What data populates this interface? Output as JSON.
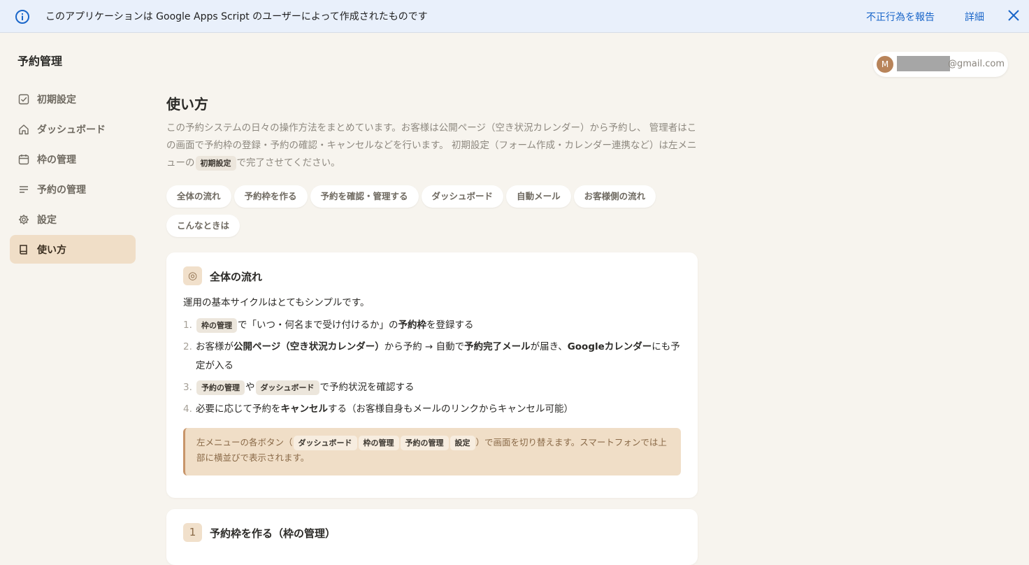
{
  "banner": {
    "message": "このアプリケーションは Google Apps Script のユーザーによって作成されたものです",
    "report_link": "不正行為を報告",
    "details_link": "詳細"
  },
  "app": {
    "title": "予約管理"
  },
  "sidebar": {
    "items": [
      {
        "label": "初期設定",
        "icon": "checkbox-icon",
        "active": false
      },
      {
        "label": "ダッシュボード",
        "icon": "home-icon",
        "active": false
      },
      {
        "label": "枠の管理",
        "icon": "calendar-icon",
        "active": false
      },
      {
        "label": "予約の管理",
        "icon": "list-icon",
        "active": false
      },
      {
        "label": "設定",
        "icon": "gear-icon",
        "active": false
      },
      {
        "label": "使い方",
        "icon": "book-icon",
        "active": true
      }
    ]
  },
  "account": {
    "avatar_initial": "M",
    "email_suffix": "@gmail.com"
  },
  "main": {
    "title": "使い方",
    "intro_part1": "この予約システムの日々の操作方法をまとめています。お客様は公開ページ（空き状況カレンダー）から予約し、 管理者はこの画面で予約枠の登録・予約の確認・キャンセルなどを行います。 初期設定（フォーム作成・カレンダー連携など）は左メニューの",
    "intro_chip": "初期設定",
    "intro_part2": "で完了させてください。",
    "section_pills": [
      "全体の流れ",
      "予約枠を作る",
      "予約を確認・管理する",
      "ダッシュボード",
      "自動メール",
      "お客様側の流れ",
      "こんなときは"
    ]
  },
  "card1": {
    "badge": "◎",
    "title": "全体の流れ",
    "lead": "運用の基本サイクルはとてもシンプルです。",
    "steps": {
      "s1": {
        "num": "1.",
        "chip": "枠の管理",
        "t1": "で「いつ・何名まで受け付けるか」の",
        "b1": "予約枠",
        "t2": "を登録する"
      },
      "s2": {
        "num": "2.",
        "t1": "お客様が",
        "b1": "公開ページ（空き状況カレンダー）",
        "t2": "から予約 → 自動で",
        "b2": "予約完了メール",
        "t3": "が届き、",
        "b3": "Googleカレンダー",
        "t4": "にも予定が入る"
      },
      "s3": {
        "num": "3.",
        "chip1": "予約の管理",
        "t1": "や",
        "chip2": "ダッシュボード",
        "t2": "で予約状況を確認する"
      },
      "s4": {
        "num": "4.",
        "t1": "必要に応じて予約を",
        "b1": "キャンセル",
        "t2": "する（お客様自身もメールのリンクからキャンセル可能）"
      }
    },
    "note": {
      "t1": "左メニューの各ボタン（",
      "chips": [
        "ダッシュボード",
        "枠の管理",
        "予約の管理",
        "設定"
      ],
      "t2": "）で画面を切り替えます。スマートフォンでは上部に横並びで表示されます。"
    }
  },
  "card2": {
    "badge": "1",
    "title": "予約枠を作る（枠の管理）"
  }
}
